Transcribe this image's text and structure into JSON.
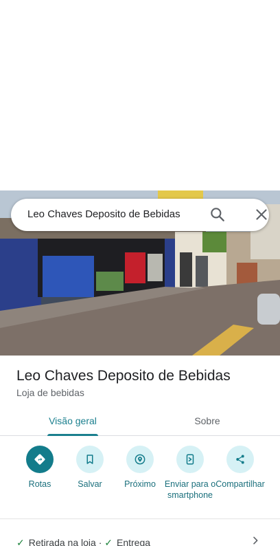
{
  "search": {
    "query": "Leo Chaves Deposito de Bebidas"
  },
  "place": {
    "name": "Leo Chaves Deposito de Bebidas",
    "category": "Loja de bebidas"
  },
  "tabs": [
    {
      "label": "Visão geral",
      "active": true
    },
    {
      "label": "Sobre",
      "active": false
    }
  ],
  "actions": [
    {
      "label": "Rotas",
      "icon": "directions-icon"
    },
    {
      "label": "Salvar",
      "icon": "bookmark-icon"
    },
    {
      "label": "Próximo",
      "icon": "nearby-icon"
    },
    {
      "label": "Enviar para o smartphone",
      "icon": "send-to-phone-icon"
    },
    {
      "label": "Compartilhar",
      "icon": "share-icon"
    }
  ],
  "services": {
    "item1": "Retirada na loja",
    "separator": "·",
    "item2": "Entrega"
  },
  "colors": {
    "accent": "#1a7f8e",
    "accent_light": "#d6f1f5",
    "check": "#188038"
  }
}
